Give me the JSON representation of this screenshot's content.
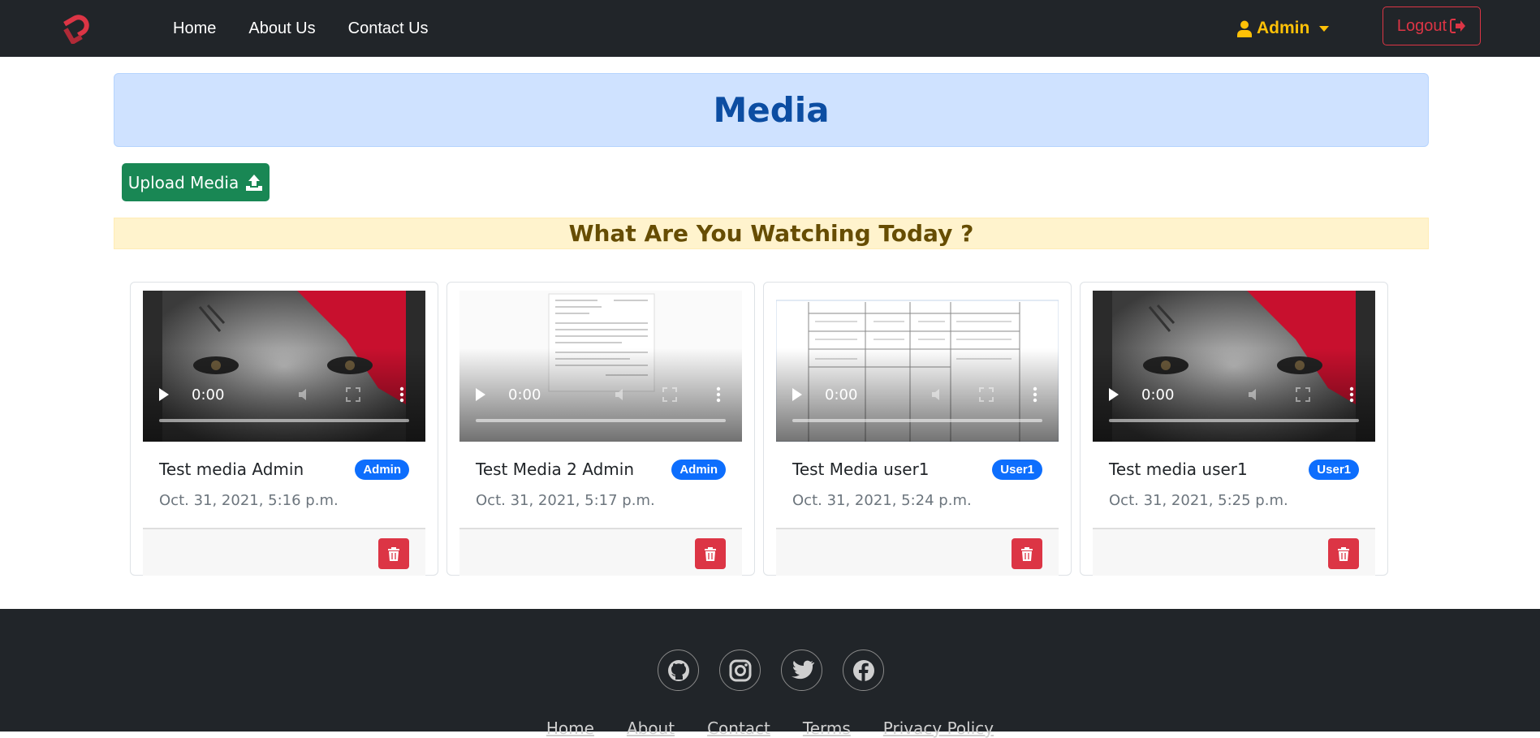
{
  "nav": {
    "links": [
      "Home",
      "About Us",
      "Contact Us"
    ],
    "user_label": "Admin",
    "logout_label": "Logout"
  },
  "page": {
    "title": "Media",
    "upload_label": "Upload Media",
    "watch_heading": "What Are You Watching Today ?"
  },
  "cards": [
    {
      "title": "Test media Admin",
      "badge": "Admin",
      "date": "Oct. 31, 2021, 5:16 p.m.",
      "time": "0:00",
      "thumb": "face-icon"
    },
    {
      "title": "Test Media 2 Admin",
      "badge": "Admin",
      "date": "Oct. 31, 2021, 5:17 p.m.",
      "time": "0:00",
      "thumb": "document-icon"
    },
    {
      "title": "Test Media user1",
      "badge": "User1",
      "date": "Oct. 31, 2021, 5:24 p.m.",
      "time": "0:00",
      "thumb": "table-icon"
    },
    {
      "title": "Test media user1",
      "badge": "User1",
      "date": "Oct. 31, 2021, 5:25 p.m.",
      "time": "0:00",
      "thumb": "face-icon"
    }
  ],
  "footer": {
    "socials": [
      "github-icon",
      "instagram-icon",
      "twitter-icon",
      "facebook-icon"
    ],
    "links": [
      "Home",
      "About",
      "Contact",
      "Terms",
      "Privacy Policy"
    ]
  },
  "colors": {
    "navbar": "#212529",
    "accent_user": "#ffc107",
    "danger": "#dc3545",
    "success": "#198754",
    "badge": "#0d6efd",
    "banner_bg": "#cfe2ff",
    "warning_bg": "#fff3cd"
  }
}
